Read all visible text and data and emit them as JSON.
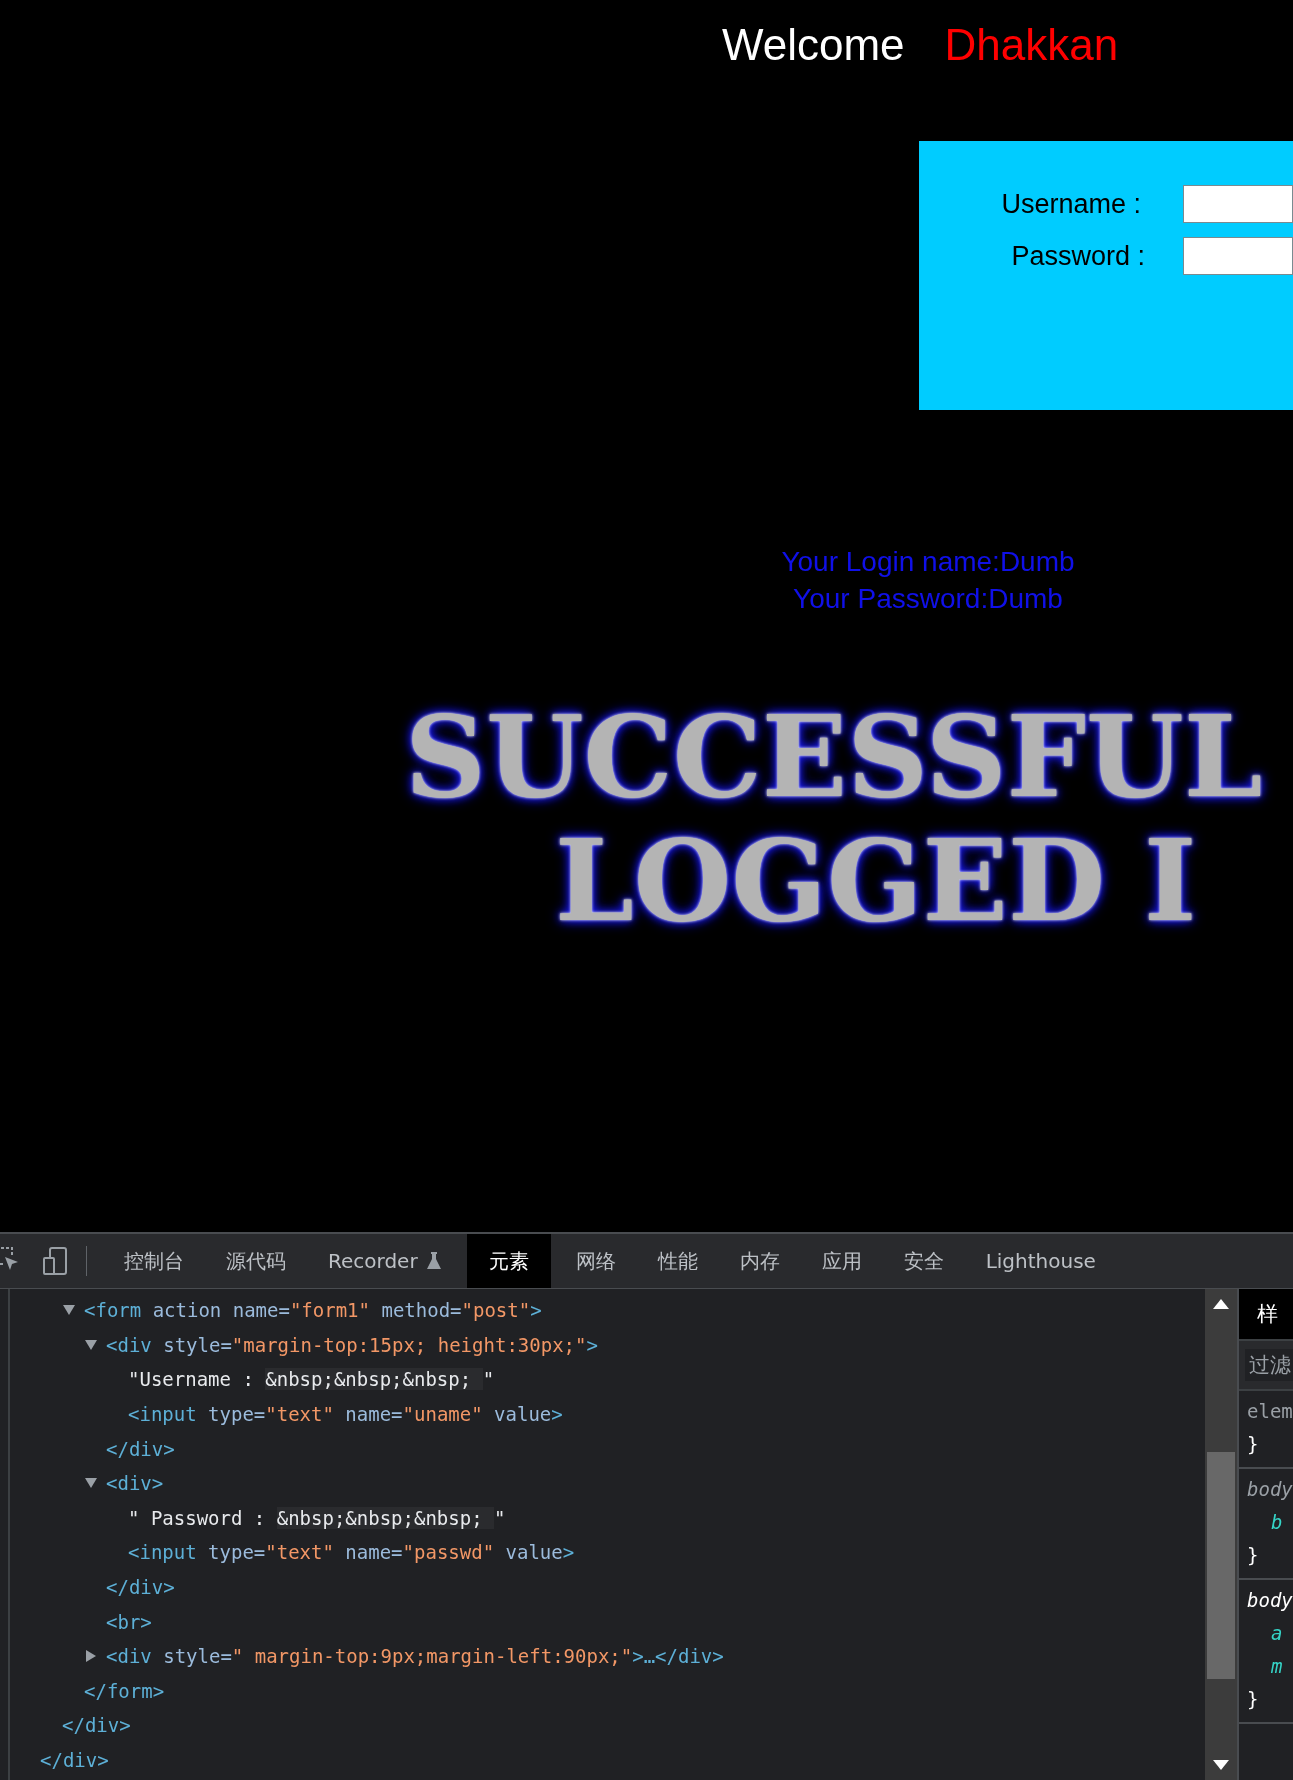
{
  "page": {
    "welcome": "Welcome",
    "user": "Dhakkan",
    "login_form": {
      "fields": [
        {
          "label": "Username :"
        },
        {
          "label": "Password :"
        }
      ]
    },
    "login_info": [
      "Your Login name:Dumb",
      "Your Password:Dumb"
    ],
    "banner": [
      "SUCCESSFUL",
      "LOGGED I"
    ]
  },
  "devtools": {
    "tabs": [
      {
        "label": "控制台",
        "selected": false
      },
      {
        "label": "源代码",
        "selected": false
      },
      {
        "label": "Recorder",
        "selected": false,
        "kind": "experimental"
      },
      {
        "label": "元素",
        "selected": true
      },
      {
        "label": "网络",
        "selected": false
      },
      {
        "label": "性能",
        "selected": false
      },
      {
        "label": "内存",
        "selected": false
      },
      {
        "label": "应用",
        "selected": false
      },
      {
        "label": "安全",
        "selected": false
      },
      {
        "label": "Lighthouse",
        "selected": false
      }
    ],
    "dom_tree": [
      {
        "children": [
          {
            "children": [
              {
                "expanded": true,
                "open": [
                  {
                    "kind": "tag",
                    "text": "<form"
                  },
                  {
                    "kind": "attr",
                    "text": " action name="
                  },
                  {
                    "kind": "value",
                    "text": "\"form1\""
                  },
                  {
                    "kind": "attr",
                    "text": " method="
                  },
                  {
                    "kind": "value",
                    "text": "\"post\""
                  },
                  {
                    "kind": "tag",
                    "text": ">"
                  }
                ],
                "children": [
                  {
                    "expanded": true,
                    "open": [
                      {
                        "kind": "tag",
                        "text": "<div"
                      },
                      {
                        "kind": "attr",
                        "text": " style="
                      },
                      {
                        "kind": "value",
                        "text": "\"margin-top:15px; height:30px;\""
                      },
                      {
                        "kind": "tag",
                        "text": ">"
                      }
                    ],
                    "children": [
                      {
                        "open": [
                          {
                            "kind": "text",
                            "text": "\"Username : "
                          },
                          {
                            "kind": "entity",
                            "text": "&nbsp;&nbsp;&nbsp; "
                          },
                          {
                            "kind": "text",
                            "text": "\""
                          }
                        ]
                      },
                      {
                        "open": [
                          {
                            "kind": "tag",
                            "text": "<input"
                          },
                          {
                            "kind": "attr",
                            "text": " type="
                          },
                          {
                            "kind": "value",
                            "text": "\"text\""
                          },
                          {
                            "kind": "attr",
                            "text": " name="
                          },
                          {
                            "kind": "value",
                            "text": "\"uname\""
                          },
                          {
                            "kind": "attr",
                            "text": " value"
                          },
                          {
                            "kind": "tag",
                            "text": ">"
                          }
                        ]
                      }
                    ],
                    "close": [
                      {
                        "kind": "tag",
                        "text": "</div>"
                      }
                    ]
                  },
                  {
                    "expanded": true,
                    "open": [
                      {
                        "kind": "tag",
                        "text": "<div>"
                      }
                    ],
                    "children": [
                      {
                        "open": [
                          {
                            "kind": "text",
                            "text": "\" Password : "
                          },
                          {
                            "kind": "entity",
                            "text": "&nbsp;&nbsp;&nbsp; "
                          },
                          {
                            "kind": "text",
                            "text": "\""
                          }
                        ]
                      },
                      {
                        "open": [
                          {
                            "kind": "tag",
                            "text": "<input"
                          },
                          {
                            "kind": "attr",
                            "text": " type="
                          },
                          {
                            "kind": "value",
                            "text": "\"text\""
                          },
                          {
                            "kind": "attr",
                            "text": " name="
                          },
                          {
                            "kind": "value",
                            "text": "\"passwd\""
                          },
                          {
                            "kind": "attr",
                            "text": " value"
                          },
                          {
                            "kind": "tag",
                            "text": ">"
                          }
                        ]
                      }
                    ],
                    "close": [
                      {
                        "kind": "tag",
                        "text": "</div>"
                      }
                    ]
                  },
                  {
                    "open": [
                      {
                        "kind": "tag",
                        "text": "<br>"
                      }
                    ]
                  },
                  {
                    "expanded": false,
                    "open": [
                      {
                        "kind": "tag",
                        "text": "<div"
                      },
                      {
                        "kind": "attr",
                        "text": " style="
                      },
                      {
                        "kind": "value",
                        "text": "\" margin-top:9px;margin-left:90px;\""
                      },
                      {
                        "kind": "tag",
                        "text": ">…</div>"
                      }
                    ]
                  }
                ],
                "close": [
                  {
                    "kind": "tag",
                    "text": "</form>"
                  }
                ]
              }
            ],
            "close": [
              {
                "kind": "tag",
                "text": "</div>"
              }
            ]
          }
        ],
        "close": [
          {
            "kind": "tag",
            "text": "</div>"
          }
        ]
      }
    ],
    "styles_panel": {
      "tab": "样",
      "filter_placeholder": "过滤",
      "rules": [
        {
          "kind": "element",
          "lines": [
            "elem",
            "}"
          ]
        },
        {
          "kind": "inherited",
          "lines": [
            "body",
            "b",
            "}"
          ]
        },
        {
          "kind": "inherited-active",
          "lines": [
            "body",
            "a",
            "m",
            "}"
          ]
        }
      ]
    }
  }
}
